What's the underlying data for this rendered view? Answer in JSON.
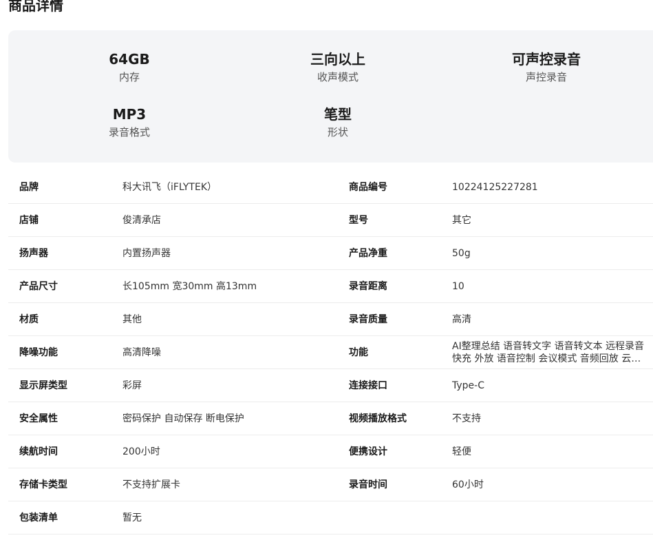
{
  "section_title": "商品详情",
  "highlights": [
    {
      "value": "64GB",
      "label": "内存"
    },
    {
      "value": "三向以上",
      "label": "收声模式"
    },
    {
      "value": "可声控录音",
      "label": "声控录音"
    },
    {
      "value": "MP3",
      "label": "录音格式"
    },
    {
      "value": "笔型",
      "label": "形状"
    }
  ],
  "specs": [
    {
      "k1": "品牌",
      "v1": "科大讯飞（iFLYTEK）",
      "k2": "商品编号",
      "v2": "10224125227281"
    },
    {
      "k1": "店铺",
      "v1": "俊清承店",
      "k2": "型号",
      "v2": "其它"
    },
    {
      "k1": "扬声器",
      "v1": "内置扬声器",
      "k2": "产品净重",
      "v2": "50g"
    },
    {
      "k1": "产品尺寸",
      "v1": "长105mm 宽30mm 高13mm",
      "k2": "录音距离",
      "v2": "10"
    },
    {
      "k1": "材质",
      "v1": "其他",
      "k2": "录音质量",
      "v2": "高清"
    },
    {
      "k1": "降噪功能",
      "v1": "高清降噪",
      "k2": "功能",
      "v2": "AI整理总结 语音转文字 语音转文本 远程录音 快充 外放 语音控制 会议模式 音频回放 云端存储"
    },
    {
      "k1": "显示屏类型",
      "v1": "彩屏",
      "k2": "连接接口",
      "v2": "Type-C"
    },
    {
      "k1": "安全属性",
      "v1": "密码保护 自动保存 断电保护",
      "k2": "视频播放格式",
      "v2": "不支持"
    },
    {
      "k1": "续航时间",
      "v1": "200小时",
      "k2": "便携设计",
      "v2": "轻便"
    },
    {
      "k1": "存储卡类型",
      "v1": "不支持扩展卡",
      "k2": "录音时间",
      "v2": "60小时"
    },
    {
      "k1": "包装清单",
      "v1": "暂无",
      "k2": "",
      "v2": ""
    }
  ]
}
